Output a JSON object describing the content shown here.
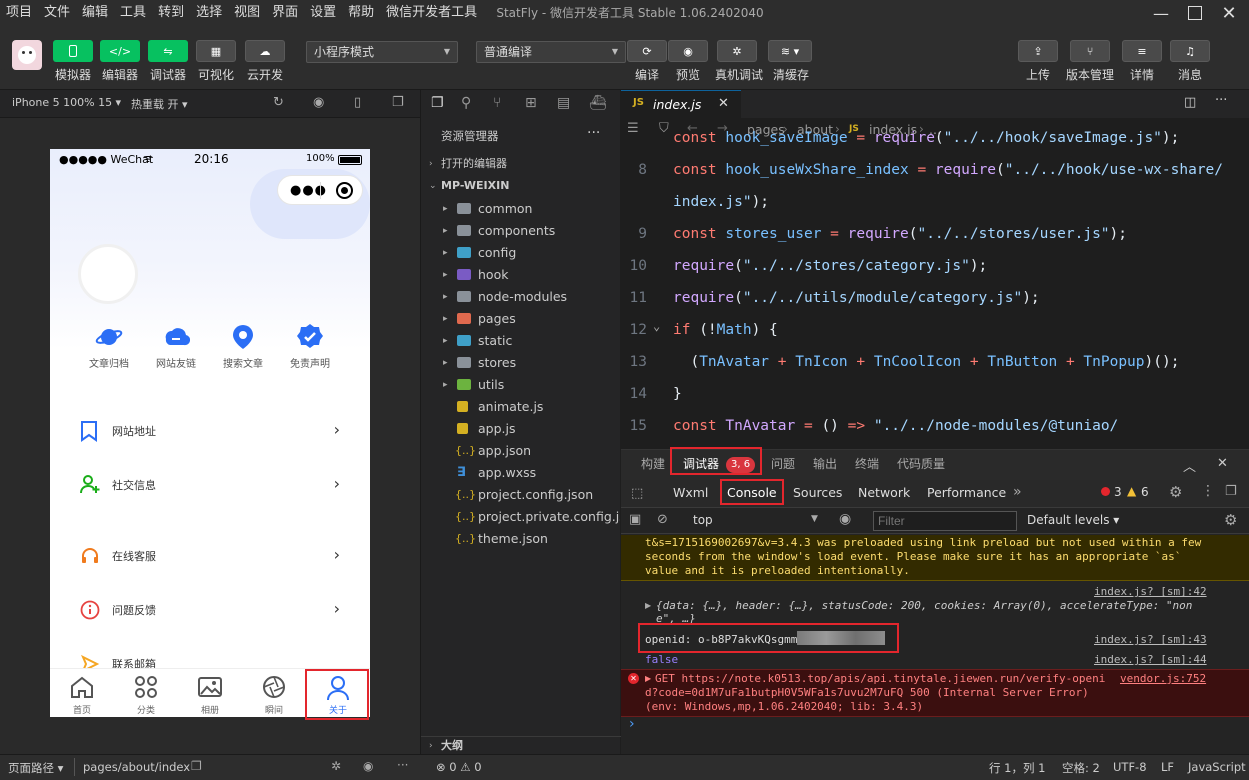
{
  "menu": [
    "项目",
    "文件",
    "编辑",
    "工具",
    "转到",
    "选择",
    "视图",
    "界面",
    "设置",
    "帮助",
    "微信开发者工具"
  ],
  "window_title": "StatFly - 微信开发者工具 Stable 1.06.2402040",
  "toolbar": {
    "left_buttons": [
      "模拟器",
      "编辑器",
      "调试器",
      "可视化",
      "云开发"
    ],
    "mode_select": "小程序模式",
    "compile_select": "普通编译",
    "mid_buttons": [
      "编译",
      "预览",
      "真机调试",
      "清缓存"
    ],
    "right_buttons": [
      "上传",
      "版本管理",
      "详情",
      "消息"
    ]
  },
  "simulator": {
    "device": "iPhone 5 100% 15 ▾",
    "hotreload": "热重载 开 ▾",
    "status_carrier": "●●●●● WeChat",
    "status_time": "20:16",
    "status_battery": "100%",
    "grid": [
      "文章归档",
      "网站友链",
      "搜索文章",
      "免责声明"
    ],
    "list": [
      "网站地址",
      "社交信息",
      "在线客服",
      "问题反馈",
      "联系邮箱"
    ],
    "tabs": [
      "首页",
      "分类",
      "相册",
      "瞬间",
      "关于"
    ],
    "colors": {
      "accent": "#2b6ef5",
      "green": "#1aad19",
      "orange": "#f07b1e",
      "red": "#e64340"
    }
  },
  "explorer": {
    "title": "资源管理器",
    "more": "···",
    "open_editors": "打开的编辑器",
    "root": "MP-WEIXIN",
    "folders": [
      "common",
      "components",
      "config",
      "hook",
      "node-modules",
      "pages",
      "static",
      "stores",
      "utils"
    ],
    "files": [
      "animate.js",
      "app.js",
      "app.json",
      "app.wxss",
      "project.config.json",
      "project.private.config.js...",
      "theme.json"
    ],
    "outline": "大纲"
  },
  "editor": {
    "tab": "index.js",
    "breadcrumb": [
      "pages",
      "about",
      "index.js",
      "..."
    ],
    "lines": [
      {
        "n": "",
        "text": "const hook_saveImage = require(\"../../hook/saveImage.js\");"
      },
      {
        "n": "8",
        "text": "const hook_useWxShare_index = require(\"../../hook/use-wx-share/"
      },
      {
        "n": "",
        "text": "index.js\");"
      },
      {
        "n": "9",
        "text": "const stores_user = require(\"../../stores/user.js\");"
      },
      {
        "n": "10",
        "text": "require(\"../../stores/category.js\");"
      },
      {
        "n": "11",
        "text": "require(\"../../utils/module/category.js\");"
      },
      {
        "n": "12",
        "text": "if (!Math) {"
      },
      {
        "n": "13",
        "text": "  (TnAvatar + TnIcon + TnCoolIcon + TnButton + TnPopup)();"
      },
      {
        "n": "14",
        "text": "}"
      },
      {
        "n": "15",
        "text": "const TnAvatar = () => \"../../node-modules/@tuniao/"
      }
    ]
  },
  "debug": {
    "tabs": [
      "构建",
      "调试器",
      "问题",
      "输出",
      "终端",
      "代码质量"
    ],
    "debugger_badge": "3, 6",
    "chrome_tabs": [
      "Wxml",
      "Console",
      "Sources",
      "Network",
      "Performance"
    ],
    "errors": "3",
    "warnings": "6",
    "context": "top",
    "filter_placeholder": "Filter",
    "levels": "Default levels ▾",
    "warning_text": [
      "t&s=17151690026​97&v=3.4.3 was preloaded using link preload but not used within a few",
      "seconds from the window's load event. Please make sure it has an appropriate `as`",
      "value and it is preloaded intentionally."
    ],
    "src1": "index.js? [sm]:42",
    "obj_line1": "{data: {…}, header: {…}, statusCode: 200, cookies: Array(0), accelerateType: \"non",
    "obj_line2": "e\", …}",
    "src2": "index.js? [sm]:43",
    "openid": "openid: o-b8P7akvKQsgmm",
    "src3": "index.js? [sm]:44",
    "false_text": "false",
    "err_line1": "GET https://note.k0513.top/apis/api.tinytale.jiewen.run/verify-openi",
    "err_line2": "d?code=0d1M7uFa1butpH0V5WFa1s7uvu2M7uFQ 500 (Internal Server Error)",
    "err_line3": "(env: Windows,mp,1.06.2402040; lib: 3.4.3)",
    "err_src": "vendor.js:752",
    "prompt": "›"
  },
  "status": {
    "path_label": "页面路径 ▾",
    "path": "pages/about/index",
    "counts": "⊗ 0 ⚠ 0",
    "position": "行 1，列 1",
    "spaces": "空格: 2",
    "encoding": "UTF-8",
    "eol": "LF",
    "lang": "JavaScript"
  }
}
